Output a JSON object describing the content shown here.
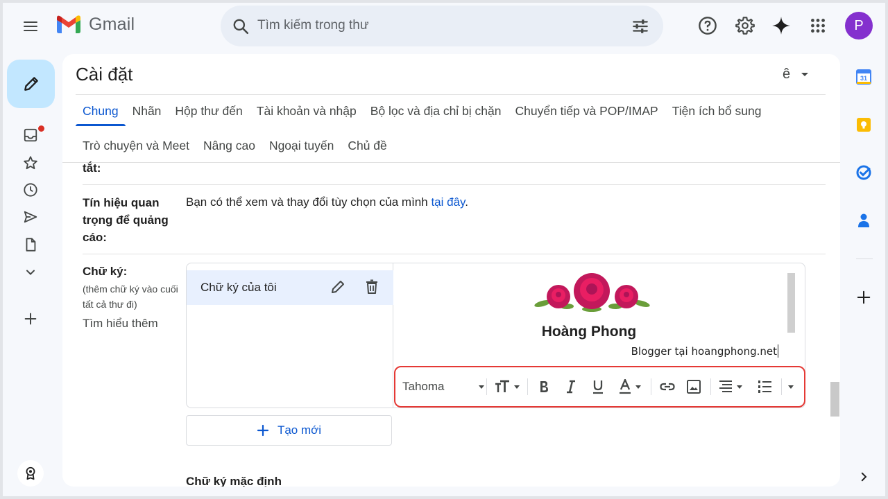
{
  "header": {
    "app_name": "Gmail",
    "search_placeholder": "Tìm kiếm trong thư",
    "avatar_initial": "P"
  },
  "settings": {
    "title": "Cài đặt",
    "input_tool": "ê",
    "tabs_row1": [
      "Chung",
      "Nhãn",
      "Hộp thư đến",
      "Tài khoản và nhập",
      "Bộ lọc và địa chỉ bị chặn",
      "Chuyển tiếp và POP/IMAP",
      "Tiện ích bổ sung"
    ],
    "tabs_row2": [
      "Trò chuyện và Meet",
      "Nâng cao",
      "Ngoại tuyến",
      "Chủ đề"
    ],
    "active_tab": "Chung",
    "partial_label": "tắt:",
    "ads": {
      "label_lines": [
        "Tín hiệu quan",
        "trọng để quảng",
        "cáo:"
      ],
      "text": "Bạn có thể xem và thay đổi tùy chọn của mình ",
      "link": "tại đây",
      "end": "."
    },
    "signature": {
      "label": "Chữ ký:",
      "hint_lines": [
        "(thêm chữ ký vào cuối",
        "tất cả thư đi)"
      ],
      "learn_more": "Tìm hiểu thêm",
      "item_name": "Chữ ký của tôi",
      "person_name": "Hoàng Phong",
      "blog_line": "Blogger tại hoangphong.net",
      "font": "Tahoma",
      "create_new": "Tạo mới",
      "default_label": "Chữ ký mặc định"
    }
  },
  "colors": {
    "accent": "#0b57d0",
    "compose_bg": "#c2e7ff",
    "highlight_border": "#e53935",
    "avatar_bg": "#8430ce"
  }
}
